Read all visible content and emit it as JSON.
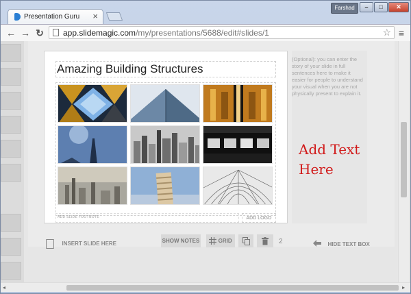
{
  "browser": {
    "tab_title": "Presentation Guru",
    "tab_close_glyph": "×",
    "user_name": "Farshad",
    "window_controls": {
      "minimize": "–",
      "maximize": "□",
      "close": "✕"
    },
    "url_host": "app.slidemagic.com",
    "url_path": "/my/presentations/5688/edit#slides/1",
    "nav_glyphs": {
      "back": "←",
      "forward": "→",
      "reload": "↻",
      "star": "☆",
      "menu": "≡"
    }
  },
  "slide": {
    "title": "Amazing Building Structures",
    "footnote_placeholder": "ADD SLIDE FOOTNOTE",
    "add_logo_label": "ADD LOGO"
  },
  "notes": {
    "placeholder": "(Optional): you can enter the story of your slide in full sentences here to make it easier for people to understand your visual when you are not physically present to explain it."
  },
  "annotation": {
    "text": "Add Text\nHere",
    "color": "#d11a1a"
  },
  "toolbar": {
    "insert_slide_label": "INSERT SLIDE HERE",
    "show_notes_label": "SHOW NOTES",
    "grid_label": "GRID",
    "slide_count": "2",
    "hide_text_box_label": "HIDE TEXT BOX"
  },
  "scrollbars": {
    "left_arrow": "◂",
    "right_arrow": "▸"
  },
  "icons": [
    "favicon-icon",
    "page-icon",
    "star-icon",
    "menu-icon",
    "insert-slide-icon",
    "grid-icon",
    "copy-icon",
    "trash-icon",
    "arrow-left-icon"
  ]
}
